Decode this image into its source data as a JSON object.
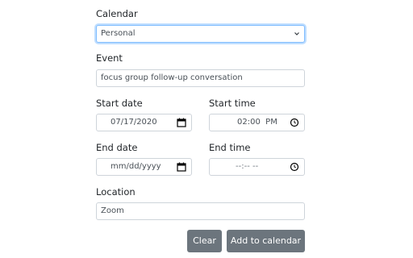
{
  "calendar": {
    "label": "Calendar",
    "value": "Personal"
  },
  "event": {
    "label": "Event",
    "value": "focus group follow-up conversation"
  },
  "start_date": {
    "label": "Start date",
    "value": "07/17/2020"
  },
  "start_time": {
    "label": "Start time",
    "value": "02:00  PM"
  },
  "end_date": {
    "label": "End date",
    "value": "mm/dd/yyyy"
  },
  "end_time": {
    "label": "End time",
    "value": "--:-- --"
  },
  "location": {
    "label": "Location",
    "value": "Zoom"
  },
  "buttons": {
    "clear": "Clear",
    "add": "Add to calendar"
  },
  "icons": {
    "select_arrow": "chevron-down-icon",
    "date_picker": "calendar-icon",
    "time_picker": "clock-icon"
  },
  "colors": {
    "button": "#6c757d",
    "focus_border": "#80bdff"
  }
}
